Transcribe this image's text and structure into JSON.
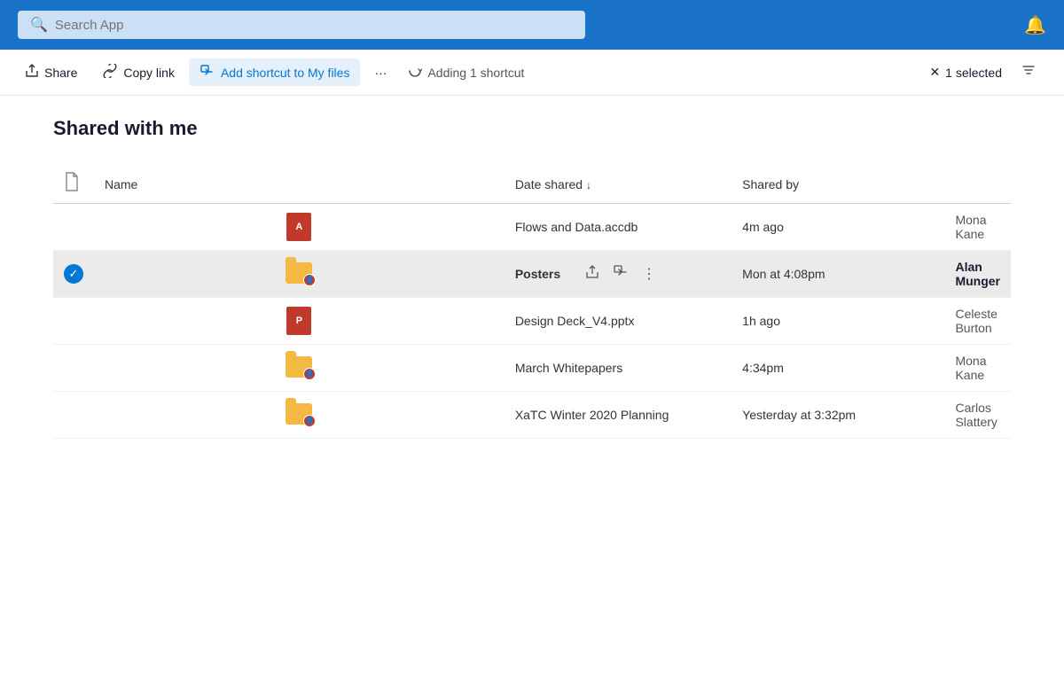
{
  "header": {
    "search_placeholder": "Search App",
    "bell_icon": "🔔"
  },
  "toolbar": {
    "share_label": "Share",
    "copy_link_label": "Copy link",
    "add_shortcut_label": "Add shortcut to My files",
    "more_label": "···",
    "adding_label": "Adding 1 shortcut",
    "selected_label": "1 selected",
    "share_icon": "↗",
    "copy_icon": "🔗",
    "shortcut_icon": "⬛",
    "refresh_icon": "↻",
    "close_icon": "✕",
    "sort_icon": "⇅"
  },
  "page": {
    "title": "Shared with me",
    "columns": {
      "name": "Name",
      "date_shared": "Date shared",
      "shared_by": "Shared by"
    }
  },
  "files": [
    {
      "id": 1,
      "name": "Flows and Data.accdb",
      "type": "access",
      "date": "4m ago",
      "shared_by": "Mona Kane",
      "selected": false,
      "bold": false
    },
    {
      "id": 2,
      "name": "Posters",
      "type": "folder-shared",
      "date": "Mon at 4:08pm",
      "shared_by": "Alan Munger",
      "selected": true,
      "bold": true
    },
    {
      "id": 3,
      "name": "Design Deck_V4.pptx",
      "type": "pptx",
      "date": "1h ago",
      "shared_by": "Celeste Burton",
      "selected": false,
      "bold": false
    },
    {
      "id": 4,
      "name": "March Whitepapers",
      "type": "folder-shared",
      "date": "4:34pm",
      "shared_by": "Mona Kane",
      "selected": false,
      "bold": false
    },
    {
      "id": 5,
      "name": "XaTC Winter 2020 Planning",
      "type": "folder-shared",
      "date": "Yesterday at 3:32pm",
      "shared_by": "Carlos Slattery",
      "selected": false,
      "bold": false
    }
  ]
}
